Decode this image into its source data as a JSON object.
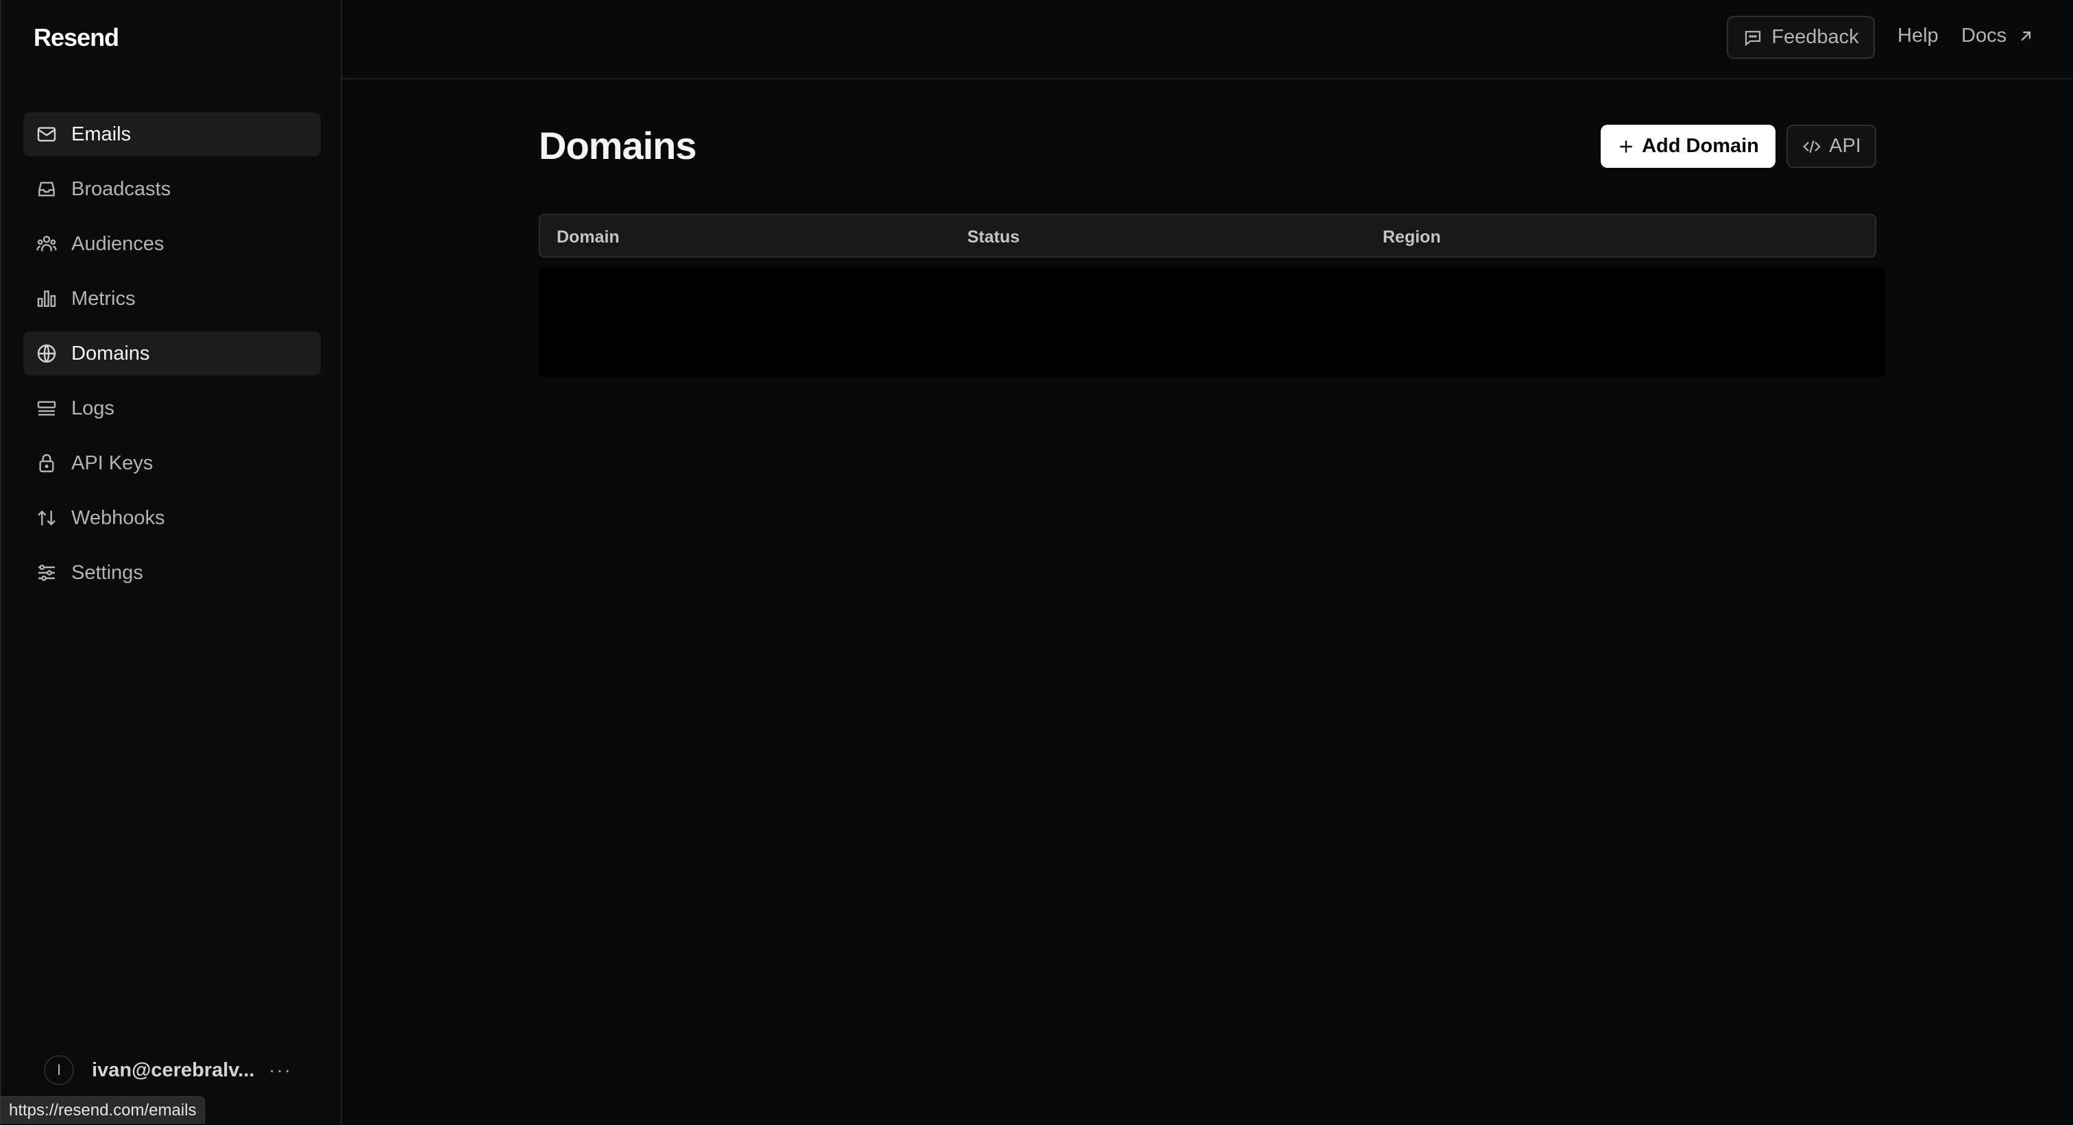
{
  "app": {
    "logo": "Resend"
  },
  "sidebar": {
    "items": [
      {
        "label": "Emails",
        "icon": "mail-icon"
      },
      {
        "label": "Broadcasts",
        "icon": "inbox-icon"
      },
      {
        "label": "Audiences",
        "icon": "users-icon"
      },
      {
        "label": "Metrics",
        "icon": "bar-chart-icon"
      },
      {
        "label": "Domains",
        "icon": "globe-icon"
      },
      {
        "label": "Logs",
        "icon": "logs-icon"
      },
      {
        "label": "API Keys",
        "icon": "lock-icon"
      },
      {
        "label": "Webhooks",
        "icon": "arrows-icon"
      },
      {
        "label": "Settings",
        "icon": "sliders-icon"
      }
    ],
    "account": {
      "avatar_initial": "I",
      "email": "ivan@cerebralv...",
      "more": "···"
    }
  },
  "topbar": {
    "feedback_label": "Feedback",
    "help_label": "Help",
    "docs_label": "Docs"
  },
  "main": {
    "title": "Domains",
    "add_domain_label": "Add Domain",
    "api_label": "API",
    "table": {
      "columns": [
        "Domain",
        "Status",
        "Region"
      ]
    }
  },
  "status_bar": {
    "url": "https://resend.com/emails"
  },
  "colors": {
    "background": "#09090b",
    "sidebar_active": "#1c1c1f",
    "primary_button": "#ffffff"
  }
}
